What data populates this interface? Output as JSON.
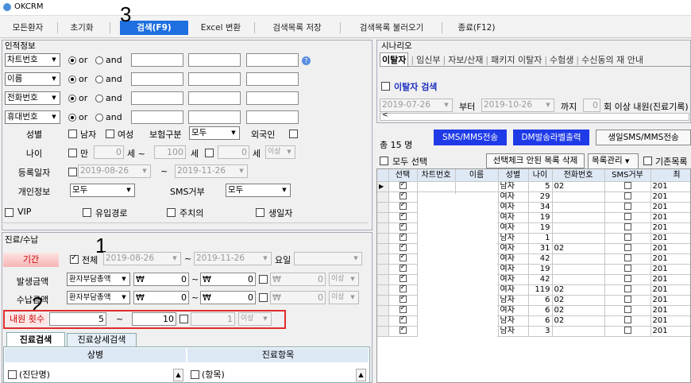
{
  "window": {
    "title": "OKCRM"
  },
  "toolbar": {
    "buttons": [
      "모든환자",
      "초기화",
      "검색(F9)",
      "Excel 변환",
      "검색목록 저장",
      "검색목록 불러오기",
      "종료(F12)"
    ]
  },
  "annotations": {
    "n1": "1",
    "n2": "2",
    "n3": "3"
  },
  "personal": {
    "header": "인적정보",
    "filters": [
      {
        "field": "차트번호",
        "or": "or",
        "and": "and"
      },
      {
        "field": "이름",
        "or": "or",
        "and": "and"
      },
      {
        "field": "전화번호",
        "or": "or",
        "and": "and"
      },
      {
        "field": "휴대번호",
        "or": "or",
        "and": "and"
      }
    ],
    "gender_label": "성별",
    "male": "남자",
    "female": "여성",
    "insurance_label": "보험구분",
    "insurance_value": "모두",
    "foreigner": "외국인",
    "age_label": "나이",
    "age_from_check": "만",
    "age_from": "0",
    "age_from_unit": "세 ~",
    "age_to": "100",
    "age_to_unit": "세",
    "age_extra": "0",
    "age_extra_unit": "세",
    "age_extra_sel": "이상",
    "reg_label": "등록일자",
    "reg_from": "2019-08-26",
    "reg_tilde": "~",
    "reg_to": "2019-11-26",
    "privacy_label": "개인정보",
    "privacy_value": "모두",
    "sms_label": "SMS거부",
    "sms_value": "모두",
    "vip": "VIP",
    "inflow": "유입경로",
    "caution": "주치의",
    "birthday": "생일자"
  },
  "treatment": {
    "header": "진료/수납",
    "period_label": "기간",
    "all": "전체",
    "from": "2019-08-26",
    "tilde": "~",
    "to": "2019-11-26",
    "weekday": "요일",
    "occur_label": "발생금액",
    "occur_type": "환자부담총액",
    "won": "₩",
    "occur_from": "0",
    "occur_to": "0",
    "occur_extra": "0",
    "occur_sel": "이상",
    "paid_label": "수납금액",
    "paid_type": "환자부담총액",
    "paid_from": "0",
    "paid_to": "0",
    "paid_extra": "0",
    "paid_sel": "이상",
    "visits_label": "내원 횟수",
    "visits_from": "5",
    "visits_to": "10",
    "visits_extra": "1",
    "visits_sel": "이상"
  },
  "tabs2": {
    "t1": "진료검색",
    "t2": "진료상세검색"
  },
  "bottom": {
    "col1": "상병",
    "col2": "진료항목",
    "item1": "(진단명)",
    "item2": "(항목)"
  },
  "scenario": {
    "header": "시나리오",
    "tabs": [
      "이탈자",
      "임신부",
      "자보/산재",
      "패키지 이탈자",
      "수험생",
      "수신동의 재 안내"
    ],
    "check_label": "이탈자 검색",
    "date_from": "2019-07-26",
    "from_word": "부터",
    "date_to": "2019-10-26",
    "to_word": "까지",
    "count": "0",
    "suffix": "회 이상 내원(진료기록)"
  },
  "results": {
    "total": "총 15 명",
    "btn_sms": "SMS/MMS전송",
    "btn_dm": "DM발송라벨출력",
    "btn_bday": "생일SMS/MMS전송",
    "select_all": "모두 선택",
    "btn_delete": "선택체크 안된 목록 삭제",
    "btn_manage": "목록관리",
    "existing": "기존목록",
    "columns": [
      "선택",
      "차트번호",
      "이름",
      "성별",
      "나이",
      "전화번호",
      "SMS거부",
      "최"
    ],
    "rows": [
      {
        "gender": "남자",
        "age": "5",
        "phone": "02",
        "year": "201"
      },
      {
        "gender": "여자",
        "age": "29",
        "phone": "",
        "year": "201"
      },
      {
        "gender": "여자",
        "age": "34",
        "phone": "",
        "year": "201"
      },
      {
        "gender": "여자",
        "age": "19",
        "phone": "",
        "year": "201"
      },
      {
        "gender": "여자",
        "age": "19",
        "phone": "",
        "year": "201"
      },
      {
        "gender": "남자",
        "age": "1",
        "phone": "",
        "year": "201"
      },
      {
        "gender": "여자",
        "age": "31",
        "phone": "02",
        "year": "201"
      },
      {
        "gender": "여자",
        "age": "42",
        "phone": "",
        "year": "201"
      },
      {
        "gender": "여자",
        "age": "19",
        "phone": "",
        "year": "201"
      },
      {
        "gender": "여자",
        "age": "42",
        "phone": "",
        "year": "201"
      },
      {
        "gender": "여자",
        "age": "119",
        "phone": "02",
        "year": "201"
      },
      {
        "gender": "남자",
        "age": "6",
        "phone": "02",
        "year": "201"
      },
      {
        "gender": "여자",
        "age": "6",
        "phone": "02",
        "year": "201"
      },
      {
        "gender": "남자",
        "age": "6",
        "phone": "02",
        "year": "201"
      },
      {
        "gender": "남자",
        "age": "3",
        "phone": "",
        "year": "201"
      }
    ]
  }
}
